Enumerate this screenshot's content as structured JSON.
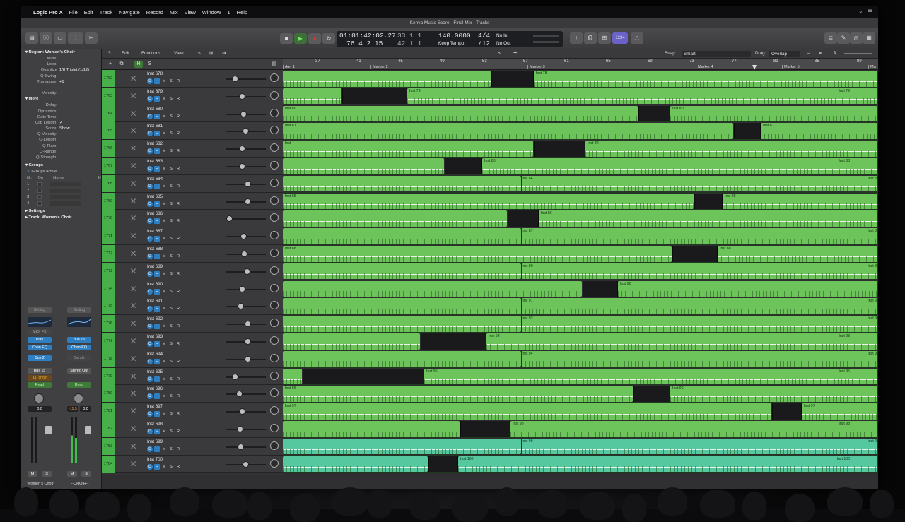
{
  "menubar": {
    "app_name": "Logic Pro X",
    "items": [
      "File",
      "Edit",
      "Track",
      "Navigate",
      "Record",
      "Mix",
      "View",
      "Window",
      "1",
      "Help"
    ]
  },
  "window_title": "Kenya Music Score - Final Mix - Tracks",
  "lcd": {
    "time": "01:01:42:02.27",
    "bars": "76  4  2    15",
    "pos_top": "33  1  1",
    "pos_bottom": "42  1  1",
    "tempo": "140.0000",
    "tempo_mode": "Keep Tempo",
    "signature_top": "4/4",
    "signature_bottom": "/12",
    "in": "No In",
    "out": "No Out"
  },
  "inspector": {
    "region_header": "Region:  Women's Choir",
    "region_rows": [
      {
        "k": "Mute:",
        "v": ""
      },
      {
        "k": "Loop:",
        "v": ""
      },
      {
        "k": "Quantize",
        "v": "1/8 Triplet (1/12)"
      },
      {
        "k": "Q-Swing:",
        "v": ""
      },
      {
        "k": "Transpose:",
        "v": "+1"
      },
      {
        "k": "",
        "v": ""
      },
      {
        "k": "Velocity:",
        "v": ""
      }
    ],
    "more_header": "More",
    "more_rows": [
      {
        "k": "Delay:",
        "v": ""
      },
      {
        "k": "Dynamics:",
        "v": ""
      },
      {
        "k": "Gate Time:",
        "v": ""
      },
      {
        "k": "Clip Length:",
        "v": "✓"
      },
      {
        "k": "Score:",
        "v": "Show"
      },
      {
        "k": "Q-Velocity:",
        "v": ""
      },
      {
        "k": "Q-Length:",
        "v": ""
      },
      {
        "k": "Q-Flam:",
        "v": ""
      },
      {
        "k": "Q-Range:",
        "v": ""
      },
      {
        "k": "Q-Strength:",
        "v": ""
      }
    ],
    "groups_header": "Groups",
    "groups_active": "Groups active",
    "groups_cols": [
      "Nr.",
      "On",
      "Name",
      "H"
    ],
    "groups_nums": [
      "1",
      "2",
      "3",
      "4"
    ],
    "settings_header": "Settings",
    "track_header": "Track:  Women's Choir"
  },
  "strip_left": {
    "setting": "Setting",
    "midi_fx": "MIDI FX",
    "play": "Play",
    "chan_eq": "Chan EQ",
    "bus": "Bus 2",
    "output": "Bus 15",
    "group": "11: choir",
    "auto": "Read",
    "value": "0.0",
    "m": "M",
    "s": "S",
    "name": "Women's Choir"
  },
  "strip_right": {
    "setting": "Setting",
    "bus": "Bus 15",
    "chan_eq": "Chan EQ",
    "sends": "Sends",
    "output": "Stereo Out",
    "auto": "Read",
    "value_l": "-11.5",
    "value_r": "0.0",
    "m": "M",
    "s": "S",
    "name": "--CHOIR--"
  },
  "tracks_toolbar": {
    "edit": "Edit",
    "functions": "Functions",
    "view": "View",
    "snap_label": "Snap:",
    "snap_value": "Smart",
    "drag_label": "Drag:",
    "drag_value": "Overlap"
  },
  "ruler": {
    "bars": [
      "37",
      "41",
      "45",
      "49",
      "53",
      "57",
      "61",
      "65",
      "69",
      "73",
      "77",
      "81",
      "85",
      "89"
    ],
    "markers": [
      "rker 1",
      "Marker 2",
      "Marker 3",
      "Marker 4",
      "Marker 5",
      "Ma"
    ]
  },
  "tracks": [
    {
      "num": "1762",
      "name": "Inst 678"
    },
    {
      "num": "1763",
      "name": "Inst 679"
    },
    {
      "num": "1764",
      "name": "Inst 680"
    },
    {
      "num": "1765",
      "name": "Inst 681"
    },
    {
      "num": "1766",
      "name": "Inst 682"
    },
    {
      "num": "1767",
      "name": "Inst 683"
    },
    {
      "num": "1768",
      "name": "Inst 684"
    },
    {
      "num": "1769",
      "name": "Inst 685"
    },
    {
      "num": "1770",
      "name": "Inst 686"
    },
    {
      "num": "1771",
      "name": "Inst 687"
    },
    {
      "num": "1772",
      "name": "Inst 688"
    },
    {
      "num": "1773",
      "name": "Inst 689"
    },
    {
      "num": "1774",
      "name": "Inst 690"
    },
    {
      "num": "1775",
      "name": "Inst 691"
    },
    {
      "num": "1776",
      "name": "Inst 692"
    },
    {
      "num": "1777",
      "name": "Inst 693"
    },
    {
      "num": "1778",
      "name": "Inst 694"
    },
    {
      "num": "1779",
      "name": "Inst 695"
    },
    {
      "num": "1780",
      "name": "Inst 696"
    },
    {
      "num": "1781",
      "name": "Inst 697"
    },
    {
      "num": "1782",
      "name": "Inst 698"
    },
    {
      "num": "1783",
      "name": "Inst 699"
    },
    {
      "num": "1784",
      "name": "Inst 700"
    }
  ],
  "region_labels": [
    [
      "",
      "Inst 78"
    ],
    [
      "",
      "Inst 79",
      "Inst 79"
    ],
    [
      "Inst 80",
      "Inst 80"
    ],
    [
      "Inst 81",
      "Inst 81"
    ],
    [
      "Inst",
      "Inst 82"
    ],
    [
      "",
      "Inst 83",
      "Inst 83"
    ],
    [
      "Inst 84",
      "Inst 8"
    ],
    [
      "Inst 85",
      "Inst 85"
    ],
    [
      "",
      "Inst 86"
    ],
    [
      "Inst 87",
      "Inst 8"
    ],
    [
      "Inst 88",
      "Inst 88"
    ],
    [
      "Inst 89",
      "Inst 8"
    ],
    [
      "",
      "Inst 90"
    ],
    [
      "Inst 91",
      "Inst 9"
    ],
    [
      "Inst 92",
      "Inst 9"
    ],
    [
      "",
      "Inst 93",
      "Inst 93"
    ],
    [
      "Inst 94",
      "Inst 9"
    ],
    [
      "",
      "Inst 95",
      "Inst 95"
    ],
    [
      "Inst 96",
      "Inst 96"
    ],
    [
      "Inst 97",
      "Inst 97"
    ],
    [
      "",
      "Inst 98",
      "Inst 98"
    ],
    [
      "Inst 99",
      "Inst 9"
    ],
    [
      "",
      "Inst 100",
      "Inst 100"
    ]
  ],
  "colors": {
    "region_green": "#6cc45b",
    "region_teal": "#55c8a0",
    "track_number": "#47b04a",
    "button_blue": "#2e7fc2",
    "record": "#d43b32",
    "play": "#4fc24a"
  }
}
